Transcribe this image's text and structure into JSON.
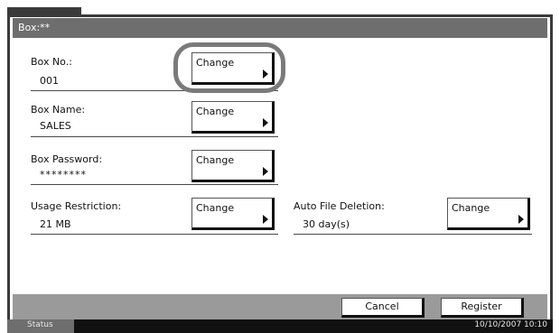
{
  "window": {
    "title": "Box:**"
  },
  "fields": {
    "box_no": {
      "label": "Box No.:",
      "value": "001",
      "button": "Change"
    },
    "box_name": {
      "label": "Box Name:",
      "value": "SALES",
      "button": "Change"
    },
    "box_password": {
      "label": "Box Password:",
      "value": "********",
      "button": "Change"
    },
    "usage_restriction": {
      "label": "Usage Restriction:",
      "value": "21 MB",
      "button": "Change"
    },
    "auto_file_deletion": {
      "label": "Auto File Deletion:",
      "value": "30 day(s)",
      "button": "Change"
    }
  },
  "footer": {
    "cancel": "Cancel",
    "register": "Register"
  },
  "statusbar": {
    "status": "Status",
    "datetime": "10/10/2007   10:10"
  },
  "colors": {
    "titlebar": "#6e6e6e",
    "footerbar": "#9a9a9a",
    "statusbar": "#111111",
    "highlight": "#7a7a7a"
  },
  "icons": {
    "change_arrow": "triangle-right-icon"
  }
}
